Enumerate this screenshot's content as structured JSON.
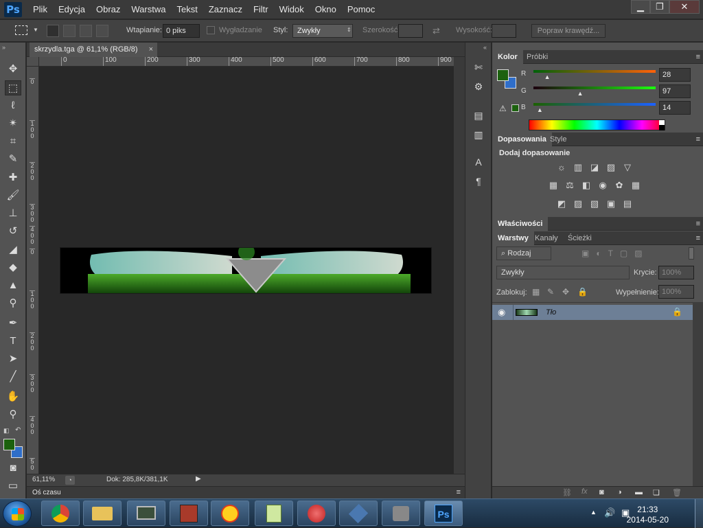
{
  "app": {
    "logo": "Ps"
  },
  "menu": [
    "Plik",
    "Edycja",
    "Obraz",
    "Warstwa",
    "Tekst",
    "Zaznacz",
    "Filtr",
    "Widok",
    "Okno",
    "Pomoc"
  ],
  "window_controls": {
    "minimize": "▁",
    "restore": "❐",
    "close": "✕"
  },
  "options": {
    "feather_label": "Wtapianie:",
    "feather_value": "0 piks",
    "antialias_label": "Wygładzanie",
    "style_label": "Styl:",
    "style_value": "Zwykły",
    "width_label": "Szerokość:",
    "height_label": "Wysokość:",
    "refine_button": "Popraw krawędź..."
  },
  "document": {
    "tab_title": "skrzydla.tga @ 61,1% (RGB/8)",
    "tab_close": "×",
    "zoom": "61,11%",
    "doc_info": "Dok: 285,8K/381,1K",
    "timeline_label": "Oś czasu"
  },
  "rulers": {
    "h": [
      "0",
      "100",
      "200",
      "300",
      "400",
      "500",
      "600",
      "700",
      "800",
      "900"
    ],
    "v": [
      "0",
      "1 0 0",
      "2 0 0",
      "3 0 0",
      "4 0 0",
      "0",
      "1 0 0",
      "2 0 0",
      "3 0 0",
      "4 0 0",
      "5 0"
    ]
  },
  "color_panel": {
    "tabs": [
      "Kolor",
      "Próbki"
    ],
    "channels": [
      {
        "name": "R",
        "value": "28",
        "fraction": 0.11
      },
      {
        "name": "G",
        "value": "97",
        "fraction": 0.38
      },
      {
        "name": "B",
        "value": "14",
        "fraction": 0.05
      }
    ],
    "foreground": "#1c610e",
    "background": "#2f6ec9"
  },
  "adjust_panel": {
    "tabs": [
      "Dopasowania",
      "Style"
    ],
    "heading": "Dodaj dopasowanie",
    "row1": [
      "☼",
      "▥",
      "◪",
      "▨",
      "▽"
    ],
    "row2": [
      "▦",
      "⚖",
      "◧",
      "◉",
      "✿",
      "▦"
    ],
    "row3": [
      "◩",
      "▨",
      "▧",
      "▣",
      "▤"
    ]
  },
  "properties_panel": {
    "tab": "Właściwości"
  },
  "layers_panel": {
    "tabs": [
      "Warstwy",
      "Kanały",
      "Ścieżki"
    ],
    "filter_label": "⌕ Rodzaj",
    "blend_mode": "Zwykły",
    "opacity_label": "Krycie:",
    "opacity_value": "100%",
    "lock_label": "Zablokuj:",
    "fill_label": "Wypełnienie:",
    "fill_value": "100%",
    "layers": [
      {
        "name": "Tło"
      }
    ]
  },
  "taskbar": {
    "clock_time": "21:33",
    "clock_date": "2014-05-20",
    "active_app": "Ps"
  }
}
